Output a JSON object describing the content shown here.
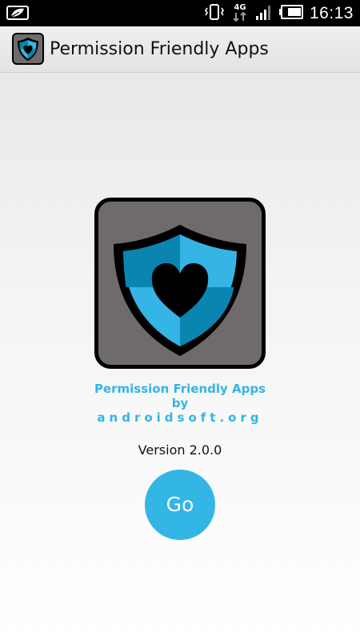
{
  "status_bar": {
    "time": "16:13",
    "network_type": "4G",
    "icons": [
      "notification-leaf-icon",
      "vibrate-icon",
      "4g-data-icon",
      "signal-icon",
      "battery-icon"
    ]
  },
  "action_bar": {
    "title": "Permission Friendly Apps",
    "icon": "shield-heart-icon"
  },
  "about": {
    "app_name": "Permission Friendly Apps",
    "by": "by",
    "site": "androidsoft.org"
  },
  "version_text": "Version 2.0.0",
  "go_button_label": "Go",
  "colors": {
    "accent": "#33b5e5",
    "shield_light": "#35b5e6",
    "shield_dark": "#0a85b0",
    "logo_background": "#6f6b6b"
  }
}
